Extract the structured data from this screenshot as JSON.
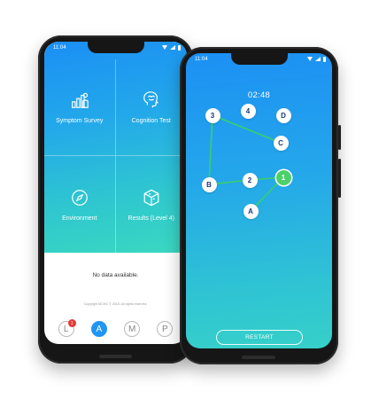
{
  "left_phone": {
    "status": {
      "time": "11:04"
    },
    "tiles": [
      {
        "label": "Symptom Survey",
        "icon": "chart-survey-icon"
      },
      {
        "label": "Cognition Test",
        "icon": "brain-icon"
      },
      {
        "label": "Environment",
        "icon": "compass-icon"
      },
      {
        "label": "Results (Level 4)",
        "icon": "cube-icon"
      }
    ],
    "empty_message": "No data available.",
    "copyright": "Copyright MCMC © 2018. All rights reserved.",
    "nav": [
      {
        "letter": "L",
        "badge": "1"
      },
      {
        "letter": "A"
      },
      {
        "letter": "M"
      },
      {
        "letter": "P"
      }
    ],
    "nav_active": "A"
  },
  "right_phone": {
    "status": {
      "time": "11:04"
    },
    "timer": "02:48",
    "nodes": [
      "3",
      "4",
      "D",
      "C",
      "B",
      "2",
      "1",
      "A"
    ],
    "connected_path": [
      "1",
      "2",
      "B",
      "3",
      "C"
    ],
    "completed_node": "1",
    "restart_label": "RESTART"
  },
  "colors": {
    "gradient_start": "#1b8ff5",
    "gradient_end": "#3ad8c0",
    "accent_blue": "#2196f3",
    "path_green": "#3ad06a",
    "badge_red": "#e53935"
  }
}
